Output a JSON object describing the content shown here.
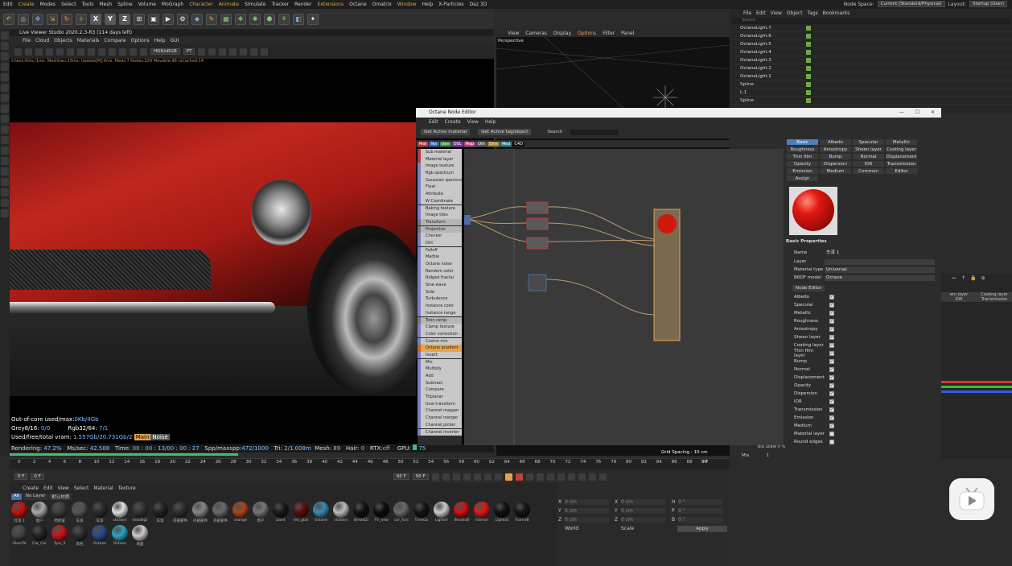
{
  "menubar": {
    "items": [
      "Edit",
      "Create",
      "Modes",
      "Select",
      "Tools",
      "Mesh",
      "Spline",
      "Volume",
      "MoGraph",
      "Character",
      "Animate",
      "Simulate",
      "Tracker",
      "Render",
      "Extensions",
      "Octane",
      "Omatrix",
      "Window",
      "Help",
      "X-Particles",
      "Daz 3D"
    ],
    "node_space_label": "Node Space:",
    "node_space_value": "Current (Standard/Physical)",
    "layout_label": "Layout:",
    "layout_value": "Startup (User)"
  },
  "live_viewer": {
    "title": "Live Viewer Studio 2020.2.3-R3 (114 days left)",
    "menu": [
      "File",
      "Cloud",
      "Objects",
      "Materials",
      "Compare",
      "Options",
      "Help",
      "GUI"
    ],
    "color_mode": "HDR/sRGB",
    "kernel": "PT",
    "status_line": "Check:0ms./1ms. MeshGen:15ms. Update[M]:0ms. Meds:7 Nodes:224 Movable:99 txCached:14",
    "stats": {
      "out_of_core_label": "Out-of-core used/max:",
      "out_of_core_value": "0Kb/4Gb",
      "grey_label": "Grey8/16:",
      "grey_value": "0/0",
      "rgb_label": "Rgb32/64:",
      "rgb_value": "7/1",
      "vram_label": "Used/free/total vram:",
      "vram_value": "1.557Gb/20.731Gb/2",
      "main_tag": "Main",
      "noise_tag": "Noise"
    },
    "render_bar": {
      "rendering_label": "Rendering:",
      "rendering_value": "47.2%",
      "ms_label": "Ms/sec:",
      "ms_value": "42.588",
      "time_label": "Time:",
      "time_value": "00 : 00 : 13/00 : 00 : 27",
      "spp_label": "Spp/maxspp:",
      "spp_value": "472/1000",
      "tri_label": "Tri:",
      "tri_value": "2/1.008m",
      "mesh_label": "Mesh:",
      "mesh_value": "89",
      "hair_label": "Hair:",
      "hair_value": "0",
      "rtx_label": "RTX:",
      "rtx_value": "off",
      "gpu_label": "GPU:",
      "gpu_value": "75"
    },
    "progress_fraction": 0.472
  },
  "timeline": {
    "ticks": [
      "0",
      "2",
      "4",
      "6",
      "8",
      "10",
      "12",
      "14",
      "16",
      "18",
      "20",
      "22",
      "24",
      "26",
      "28",
      "30",
      "32",
      "34",
      "36",
      "38",
      "40",
      "42",
      "44",
      "46",
      "48",
      "50",
      "52",
      "54",
      "56",
      "58",
      "60",
      "62",
      "64",
      "66",
      "68",
      "70",
      "72",
      "74",
      "76",
      "78",
      "80",
      "82",
      "84",
      "86",
      "88",
      "90"
    ],
    "end_label": "0 F",
    "start_frame": "0 F",
    "current_frame": "0 F",
    "end_frame_a": "90 F",
    "end_frame_b": "90 F"
  },
  "material_manager": {
    "menu": [
      "Create",
      "Edit",
      "View",
      "Select",
      "Material",
      "Texture"
    ],
    "filters": [
      "All",
      "No Layer",
      "默认材质"
    ],
    "row1": [
      {
        "name": "红漆 1",
        "color": "#c4140e"
      },
      {
        "name": "窗户",
        "color": "#aaaaaa"
      },
      {
        "name": "挡风玻",
        "color": "#3c3c3c"
      },
      {
        "name": "车漆",
        "color": "#555555"
      },
      {
        "name": "车漆",
        "color": "#2a2a2a"
      },
      {
        "name": "stickers",
        "color": "#e0e0e0"
      },
      {
        "name": "headligt",
        "color": "#333333"
      },
      {
        "name": "车漆",
        "color": "#222222"
      },
      {
        "name": "内部部件",
        "color": "#2e2e2e"
      },
      {
        "name": "内部部件",
        "color": "#888888"
      },
      {
        "name": "内部部件",
        "color": "#6a6a6a"
      },
      {
        "name": "orange",
        "color": "#b0451e"
      },
      {
        "name": "默产",
        "color": "#777777"
      },
      {
        "name": "paint",
        "color": "#1a1a1a"
      },
      {
        "name": "red_glas",
        "color": "#5a0c0c"
      },
      {
        "name": "Octane",
        "color": "#3a8ab0"
      },
      {
        "name": "stickers",
        "color": "#bbbbbb"
      },
      {
        "name": "BreakDi",
        "color": "#111111"
      },
      {
        "name": "TV_new",
        "color": "#0d0d0d"
      },
      {
        "name": "car_forc",
        "color": "#6a6a6a"
      },
      {
        "name": "TiresGu",
        "color": "#141414"
      },
      {
        "name": "LightsF",
        "color": "#cccccc"
      },
      {
        "name": "BreaksB",
        "color": "#d01010"
      },
      {
        "name": "Interiol",
        "color": "#e01818"
      },
      {
        "name": "LightsG",
        "color": "#111111"
      },
      {
        "name": "FrameB",
        "color": "#151515"
      }
    ],
    "row2": [
      {
        "name": "GlossTe",
        "color": "#444444"
      },
      {
        "name": "Car_Car",
        "color": "#222222"
      },
      {
        "name": "Tyre_3",
        "color": "#c8141a"
      },
      {
        "name": "黑色",
        "color": "#2c2c2c"
      },
      {
        "name": "Octane",
        "color": "#2a4a8a"
      },
      {
        "name": "Octane",
        "color": "#2aa4c0"
      },
      {
        "name": "地面",
        "color": "#cccccc"
      }
    ]
  },
  "coordinates": {
    "rows": [
      {
        "axis": "X",
        "pos": "0 cm",
        "axis2": "X",
        "size": "0 cm",
        "axis3": "H",
        "rot": "0 °"
      },
      {
        "axis": "Y",
        "pos": "0 cm",
        "axis2": "Y",
        "size": "0 cm",
        "axis3": "P",
        "rot": "0 °"
      },
      {
        "axis": "Z",
        "pos": "0 cm",
        "axis2": "Z",
        "size": "0 cm",
        "axis3": "B",
        "rot": "0 °"
      }
    ],
    "mode_a": "World",
    "mode_b": "Scale",
    "apply": "Apply"
  },
  "viewport": {
    "menu": [
      "View",
      "Cameras",
      "Display",
      "Options",
      "Filter",
      "Panel"
    ],
    "label": "Perspective",
    "grid_spacing": "Grid Spacing : 10 cm"
  },
  "object_manager": {
    "menu": [
      "File",
      "Edit",
      "View",
      "Object",
      "Tags",
      "Bookmarks"
    ],
    "search_placeholder": "Search",
    "rows": [
      "OctaneLight.7",
      "OctaneLight.6",
      "OctaneLight.5",
      "OctaneLight.4",
      "OctaneLight.3",
      "OctaneLight.2",
      "OctaneLight.1",
      "Spline",
      "L.1",
      "Spline"
    ]
  },
  "node_editor": {
    "title": "Octane Node Editor",
    "window_controls": [
      "—",
      "☐",
      "✕"
    ],
    "menu": [
      "Edit",
      "Create",
      "View",
      "Help"
    ],
    "btn_active_material": "Get Active material",
    "btn_active_tag": "Get Active tag/object",
    "search_label": "Search",
    "tabs": [
      {
        "label": "Mat",
        "color": "#c0383c"
      },
      {
        "label": "Tex",
        "color": "#3a5fb0"
      },
      {
        "label": "Gen",
        "color": "#3a8a3a"
      },
      {
        "label": "OSL",
        "color": "#7a3aa0"
      },
      {
        "label": "Map",
        "color": "#c03a8a"
      },
      {
        "label": "Oth",
        "color": "#555555"
      },
      {
        "label": "Ems",
        "color": "#a07a20"
      },
      {
        "label": "Med",
        "color": "#20808a"
      },
      {
        "label": "C4D",
        "color": "#111111"
      }
    ],
    "node_list": [
      {
        "label": "Sub material",
        "kind": "r"
      },
      {
        "label": "Material layer",
        "kind": "r"
      },
      {
        "label": "Image texture",
        "kind": "g"
      },
      {
        "label": "Rgb spectrum",
        "kind": "g"
      },
      {
        "label": "Gaussian spectrum",
        "kind": "g"
      },
      {
        "label": "Float",
        "kind": "g"
      },
      {
        "label": "Attribute",
        "kind": "g"
      },
      {
        "label": "W Coordinate",
        "kind": "g"
      },
      {
        "label": "Baking texture",
        "kind": "g"
      },
      {
        "label": "Image tiles",
        "kind": "g"
      },
      {
        "label": "Transform",
        "kind": "gr"
      },
      {
        "label": "Projection",
        "kind": "gr"
      },
      {
        "label": "Checker",
        "kind": "g"
      },
      {
        "label": "Dirt",
        "kind": "g"
      },
      {
        "label": "Falloff",
        "kind": "g"
      },
      {
        "label": "Marble",
        "kind": "g"
      },
      {
        "label": "Octane noise",
        "kind": "g"
      },
      {
        "label": "Random color",
        "kind": "g"
      },
      {
        "label": "Ridged fractal",
        "kind": "g"
      },
      {
        "label": "Sine wave",
        "kind": "g"
      },
      {
        "label": "Side",
        "kind": "g"
      },
      {
        "label": "Turbulence",
        "kind": "g"
      },
      {
        "label": "Instance color",
        "kind": "g"
      },
      {
        "label": "Instance range",
        "kind": "g"
      },
      {
        "label": "Toon ramp",
        "kind": "gr"
      },
      {
        "label": "Clamp texture",
        "kind": "g"
      },
      {
        "label": "Color correction",
        "kind": "g"
      },
      {
        "label": "Cosine mix",
        "kind": "g"
      },
      {
        "label": "Octane gradient",
        "kind": "o"
      },
      {
        "label": "Invert",
        "kind": "g"
      },
      {
        "label": "Mix",
        "kind": "g"
      },
      {
        "label": "Multiply",
        "kind": "g"
      },
      {
        "label": "Add",
        "kind": "g"
      },
      {
        "label": "Subtract",
        "kind": "g"
      },
      {
        "label": "Compare",
        "kind": "g"
      },
      {
        "label": "Triplanar",
        "kind": "g"
      },
      {
        "label": "Uvw transform",
        "kind": "g"
      },
      {
        "label": "Channel mapper",
        "kind": "g"
      },
      {
        "label": "Channel merger",
        "kind": "g"
      },
      {
        "label": "Channel picker",
        "kind": "g"
      },
      {
        "label": "Channel inverter",
        "kind": "g"
      }
    ],
    "property_tabs": [
      "Basic",
      "Albedo",
      "Specular",
      "Metallic",
      "Roughness",
      "Anisotropy",
      "Sheen layer",
      "Coating layer",
      "Thin film layer",
      "Bump",
      "Normal",
      "Displacement",
      "Opacity",
      "Dispersion",
      "IOR",
      "Transmission",
      "Emission",
      "Medium",
      "Common",
      "Editor",
      "Assign"
    ],
    "basic_properties_title": "Basic Properties",
    "name_label": "Name",
    "name_value": "车漆 1",
    "layer_label": "Layer",
    "material_type_label": "Material type",
    "material_type_value": "Universal",
    "brdf_label": "BRDF model",
    "brdf_value": "Octane",
    "node_editor_btn": "Node Editor",
    "channels": [
      {
        "label": "Albedo",
        "checked": true
      },
      {
        "label": "Specular",
        "checked": true
      },
      {
        "label": "Metallic",
        "checked": true
      },
      {
        "label": "Roughness",
        "checked": true
      },
      {
        "label": "Anisotropy",
        "checked": true
      },
      {
        "label": "Sheen layer",
        "checked": true
      },
      {
        "label": "Coating layer",
        "checked": true
      },
      {
        "label": "Thin film layer",
        "checked": true
      },
      {
        "label": "Bump",
        "checked": true
      },
      {
        "label": "Normal",
        "checked": true
      },
      {
        "label": "Displacement",
        "checked": true
      },
      {
        "label": "Opacity",
        "checked": true
      },
      {
        "label": "Dispersion",
        "checked": true
      },
      {
        "label": "IOR",
        "checked": true
      },
      {
        "label": "Transmission",
        "checked": true
      },
      {
        "label": "Emission",
        "checked": true
      },
      {
        "label": "Medium",
        "checked": true
      },
      {
        "label": "Material layer",
        "checked": false
      },
      {
        "label": "Round edges",
        "checked": false
      }
    ]
  },
  "right_panel": {
    "tabs_a": [
      "ern layer",
      "Coating layer"
    ],
    "tabs_b": [
      "IOR",
      "Transmission"
    ]
  },
  "blue_scale_label": "Blu Scale",
  "blue_scale_value": "0 %",
  "mix_label": "Mix",
  "mix_value": "1"
}
